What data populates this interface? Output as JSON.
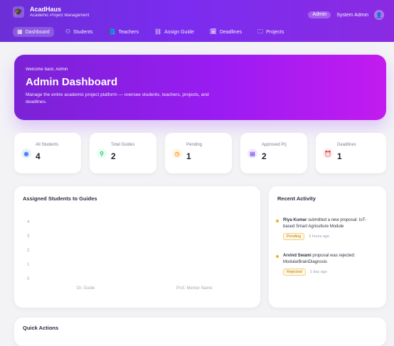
{
  "header": {
    "brand_title": "AcadHaus",
    "brand_subtitle": "Academic Project Management",
    "role_badge": "Admin",
    "user_name": "System Admin",
    "nav": [
      {
        "label": "Dashboard",
        "icon": "grid-icon",
        "active": true
      },
      {
        "label": "Students",
        "icon": "users-icon",
        "active": false
      },
      {
        "label": "Teachers",
        "icon": "book-icon",
        "active": false
      },
      {
        "label": "Assign Guide",
        "icon": "link-icon",
        "active": false
      },
      {
        "label": "Deadlines",
        "icon": "calendar-icon",
        "active": false
      },
      {
        "label": "Projects",
        "icon": "folder-icon",
        "active": false
      }
    ]
  },
  "hero": {
    "welcome": "Welcome back, Admin",
    "title": "Admin Dashboard",
    "description": "Manage the entire academic project platform — oversee students, teachers, projects, and deadlines."
  },
  "stats": [
    {
      "label": "All Students",
      "value": "4",
      "icon": "users-icon",
      "tint": "#e9f1ff",
      "color": "#3b82f6"
    },
    {
      "label": "Total Guides",
      "value": "2",
      "icon": "user-check-icon",
      "tint": "#e9fff3",
      "color": "#22c55e"
    },
    {
      "label": "Pending",
      "value": "1",
      "icon": "clock-icon",
      "tint": "#fff5e6",
      "color": "#f59e0b"
    },
    {
      "label": "Approved Prj",
      "value": "2",
      "icon": "document-icon",
      "tint": "#f1ecff",
      "color": "#8b5cf6"
    },
    {
      "label": "Deadlines",
      "value": "1",
      "icon": "alarm-icon",
      "tint": "#ffecef",
      "color": "#ef4444"
    }
  ],
  "chart": {
    "title": "Assigned Students to Guides",
    "x_labels": [
      "Dr. Guide",
      "Prof. Mentor Name"
    ],
    "y_ticks": [
      "4",
      "3",
      "2",
      "1",
      "0"
    ]
  },
  "activity": {
    "title": "Recent Activity",
    "items": [
      {
        "name": "Riya Kumar",
        "text": "submitted a new proposal: IoT-based Smart Agriculture Module",
        "status": "Pending",
        "time": "3 hours ago"
      },
      {
        "name": "Arvind Swami",
        "text": "proposal was rejected: ModularBrainDiagnosis",
        "status": "Rejected",
        "time": "1 day ago"
      }
    ]
  },
  "quick_actions": {
    "title": "Quick Actions"
  }
}
